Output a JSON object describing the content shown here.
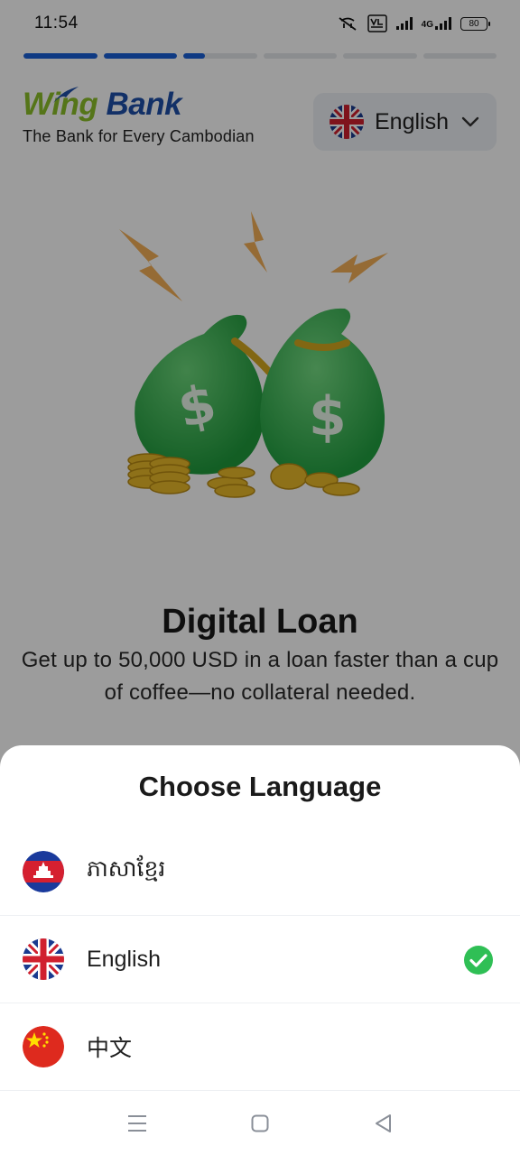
{
  "status_bar": {
    "time": "11:54",
    "network_label": "4G",
    "volte_label": "VoLTE",
    "battery": "80"
  },
  "onboarding": {
    "progress": [
      1,
      1,
      0.3,
      0,
      0,
      0
    ],
    "brand": {
      "wing": "Wing",
      "bank": "Bank"
    },
    "tagline": "The Bank for Every Cambodian",
    "language_button": {
      "label": "English",
      "flag": "uk-flag"
    },
    "hero_icon": "money-bags-illustration",
    "title": "Digital Loan",
    "subtitle": "Get up to 50,000 USD in a loan faster than a cup of coffee—no collateral needed."
  },
  "language_sheet": {
    "title": "Choose Language",
    "options": [
      {
        "label": "ភាសាខ្មែរ",
        "flag": "cambodia-flag",
        "selected": false
      },
      {
        "label": "English",
        "flag": "uk-flag",
        "selected": true
      },
      {
        "label": "中文",
        "flag": "china-flag",
        "selected": false
      }
    ]
  },
  "nav_bar": {
    "icons": [
      "menu-icon",
      "home-icon",
      "back-icon"
    ]
  },
  "colors": {
    "brand_green": "#8cbf2a",
    "brand_blue": "#1e4fa8",
    "progress_blue": "#1a5fd6",
    "check_green": "#2fbf55"
  }
}
